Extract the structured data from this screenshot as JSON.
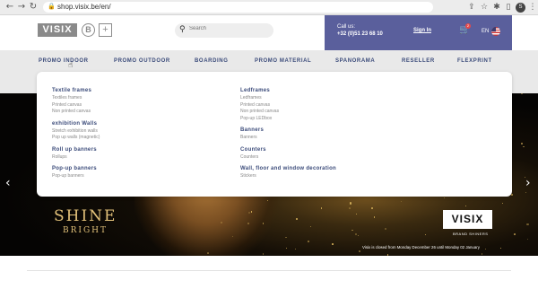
{
  "browser": {
    "back": "←",
    "forward": "→",
    "reload": "↻",
    "url": "shop.visix.be/en/",
    "profile_initial": "S"
  },
  "header": {
    "logo_text": "VISIX",
    "logo_b": "B",
    "logo_plus": "+",
    "search_placeholder": "Search",
    "call_label": "Call us:",
    "call_number": "+32 (0)51 23 68 10",
    "sign_in": "Sign In",
    "cart_count": "2",
    "language": "EN"
  },
  "nav": {
    "items": [
      "PROMO INDOOR",
      "PROMO OUTDOOR",
      "BOARDING",
      "PROMO MATERIAL",
      "SPANORAMA",
      "RESELLER",
      "FLEXPRINT"
    ]
  },
  "mega_menu": {
    "left": [
      {
        "title": "Textile frames",
        "items": [
          "Textiles frames",
          "Printed canvas",
          "Non printed canvas"
        ]
      },
      {
        "title": "exhibition Walls",
        "items": [
          "Stretch exhibition walls",
          "Pop up walls (magnetic)"
        ]
      },
      {
        "title": "Roll up banners",
        "items": [
          "Rollups"
        ]
      },
      {
        "title": "Pop-up banners",
        "items": [
          "Pop-up banners"
        ]
      }
    ],
    "right": [
      {
        "title": "Ledframes",
        "items": [
          "Ledframes",
          "Printed canvas",
          "Non printed canvas",
          "Pop-up LEDbox"
        ]
      },
      {
        "title": "Banners",
        "items": [
          "Banners"
        ]
      },
      {
        "title": "Counters",
        "items": [
          "Counters"
        ]
      },
      {
        "title": "Wall, floor and window decoration",
        "items": [
          "Stickers"
        ]
      }
    ]
  },
  "hero": {
    "headline": "SHINE",
    "subline": "BRIGHT",
    "badge": "VISIX",
    "badge_caption": "BRAND SHINERS",
    "notice": "Visix is closed from Monday December 26 until Monday 02 January",
    "prev": "‹",
    "next": "›"
  }
}
